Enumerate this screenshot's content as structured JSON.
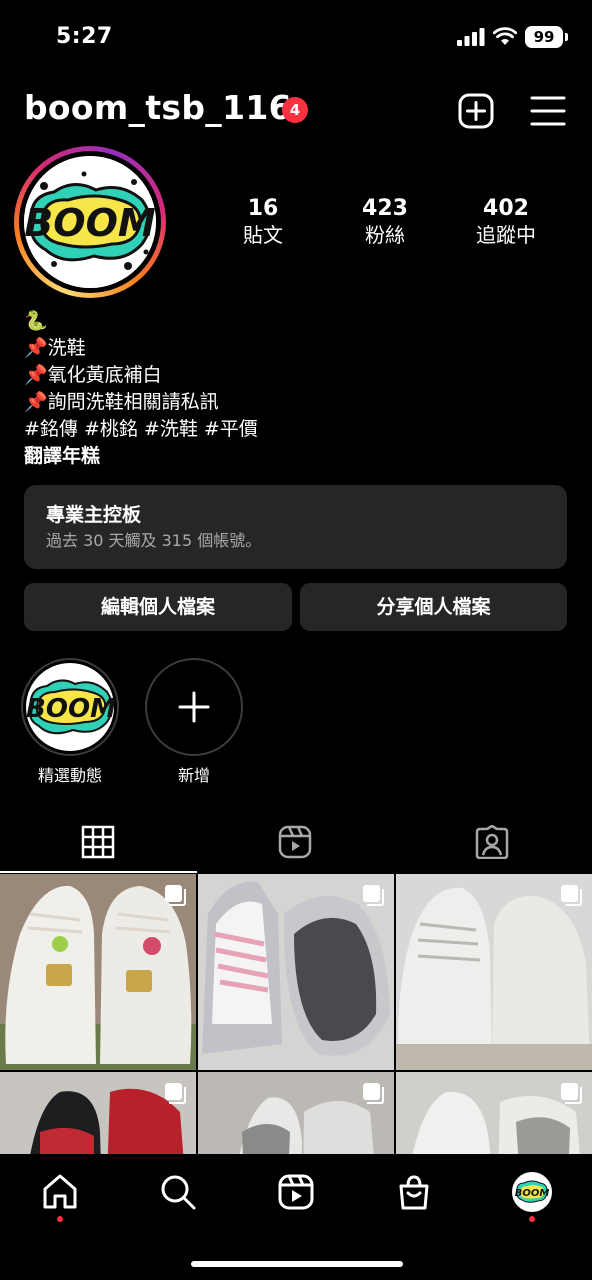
{
  "status_bar": {
    "time": "5:27",
    "battery": "99"
  },
  "header": {
    "username": "boom_tsb_116",
    "notification_count": "4"
  },
  "logo_text": "BOOM",
  "stats": [
    {
      "value": "16",
      "label": "貼文"
    },
    {
      "value": "423",
      "label": "粉絲"
    },
    {
      "value": "402",
      "label": "追蹤中"
    }
  ],
  "bio": {
    "lines": [
      "🐍",
      "📌洗鞋",
      "📌氧化黃底補白",
      "📌詢問洗鞋相關請私訊",
      "#銘傳 #桃銘 #洗鞋 #平價"
    ],
    "translate": "翻譯年糕"
  },
  "dashboard": {
    "title": "專業主控板",
    "subtitle": "過去 30 天觸及 315 個帳號。"
  },
  "buttons": {
    "edit": "編輯個人檔案",
    "share": "分享個人檔案"
  },
  "highlights": [
    {
      "label": "精選動態"
    },
    {
      "label": "新增"
    }
  ],
  "colors": {
    "background": "#000000",
    "surface": "#262626",
    "badge": "#ff3040",
    "muted": "#a8a8a8"
  }
}
